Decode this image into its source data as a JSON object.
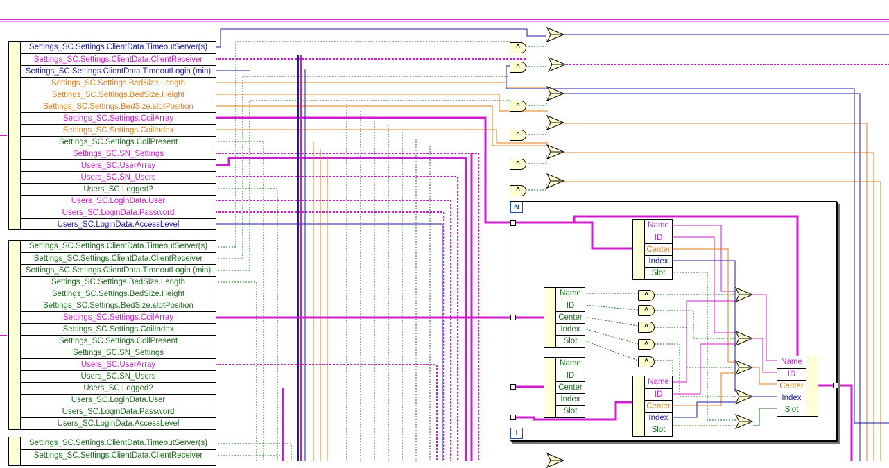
{
  "clusters": [
    {
      "rows": [
        {
          "label": "Settings_SC.Settings.ClientData.TimeoutServer(s)",
          "color": "#1a1aa6"
        },
        {
          "label": "Settings_SC.Settings.ClientData.ClientReceiver",
          "color": "#d01ccf"
        },
        {
          "label": "Settings_SC.Settings.ClientData.TimeoutLogin (min)",
          "color": "#1a1aa6"
        },
        {
          "label": "Settings_SC.Settings.BedSize.Length",
          "color": "#e07e1a"
        },
        {
          "label": "Settings_SC.Settings.BedSize.Height",
          "color": "#e07e1a"
        },
        {
          "label": "Settings_SC.Settings.BedSize.slotPosition",
          "color": "#e07e1a"
        },
        {
          "label": "Settings_SC.Settings.CoilArray",
          "color": "#d01ccf"
        },
        {
          "label": "Settings_SC.Settings.CoilIndex",
          "color": "#e07e1a"
        },
        {
          "label": "Settings_SC.Settings.CoilPresent",
          "color": "#1c6e1c"
        },
        {
          "label": "Settings_SC.SN_Settings",
          "color": "#d01ccf"
        },
        {
          "label": "Users_SC.UserArray",
          "color": "#d01ccf"
        },
        {
          "label": "Users_SC.SN_Users",
          "color": "#d01ccf"
        },
        {
          "label": "Users_SC.Logged?",
          "color": "#1c6e1c"
        },
        {
          "label": "Users_SC.LoginData.User",
          "color": "#d01ccf"
        },
        {
          "label": "Users_SC.LoginData.Password",
          "color": "#d01ccf"
        },
        {
          "label": "Users_SC.LoginData.AccessLevel",
          "color": "#1a1aa6"
        }
      ]
    },
    {
      "rows": [
        {
          "label": "Settings_SC.Settings.ClientData.TimeoutServer(s)",
          "color": "#1c6e1c"
        },
        {
          "label": "Settings_SC.Settings.ClientData.ClientReceiver",
          "color": "#1c6e1c"
        },
        {
          "label": "Settings_SC.Settings.ClientData.TimeoutLogin (min)",
          "color": "#1c6e1c"
        },
        {
          "label": "Settings_SC.Settings.BedSize.Length",
          "color": "#1c6e1c"
        },
        {
          "label": "Settings_SC.Settings.BedSize.Height",
          "color": "#1c6e1c"
        },
        {
          "label": "Settings_SC.Settings.BedSize.slotPosition",
          "color": "#1c6e1c"
        },
        {
          "label": "Settings_SC.Settings.CoilArray",
          "color": "#d01ccf"
        },
        {
          "label": "Settings_SC.Settings.CoilIndex",
          "color": "#1c6e1c"
        },
        {
          "label": "Settings_SC.Settings.CoilPresent",
          "color": "#1c6e1c"
        },
        {
          "label": "Settings_SC.SN_Settings",
          "color": "#1c6e1c"
        },
        {
          "label": "Users_SC.UserArray",
          "color": "#d01ccf"
        },
        {
          "label": "Users_SC.SN_Users",
          "color": "#1c6e1c"
        },
        {
          "label": "Users_SC.Logged?",
          "color": "#1c6e1c"
        },
        {
          "label": "Users_SC.LoginData.User",
          "color": "#1c6e1c"
        },
        {
          "label": "Users_SC.LoginData.Password",
          "color": "#1c6e1c"
        },
        {
          "label": "Users_SC.LoginData.AccessLevel",
          "color": "#1c6e1c"
        }
      ]
    },
    {
      "rows": [
        {
          "label": "Settings_SC.Settings.ClientData.TimeoutServer(s)",
          "color": "#1c6e1c"
        },
        {
          "label": "Settings_SC.Settings.ClientData.ClientReceiver",
          "color": "#1c6e1c"
        }
      ]
    }
  ],
  "coil_clusters": {
    "top": [
      {
        "label": "Name",
        "color": "#d01ccf"
      },
      {
        "label": "ID",
        "color": "#d01ccf"
      },
      {
        "label": "Center",
        "color": "#e07e1a"
      },
      {
        "label": "Index",
        "color": "#1a1aa6"
      },
      {
        "label": "Slot",
        "color": "#1c6e1c"
      }
    ],
    "left_a": [
      {
        "label": "Name",
        "color": "#1c6e1c"
      },
      {
        "label": "ID",
        "color": "#1c6e1c"
      },
      {
        "label": "Center",
        "color": "#1c6e1c"
      },
      {
        "label": "Index",
        "color": "#1c6e1c"
      },
      {
        "label": "Slot",
        "color": "#1c6e1c"
      }
    ],
    "left_b": [
      {
        "label": "Name",
        "color": "#1c6e1c"
      },
      {
        "label": "ID",
        "color": "#1c6e1c"
      },
      {
        "label": "Center",
        "color": "#1c6e1c"
      },
      {
        "label": "Index",
        "color": "#1c6e1c"
      },
      {
        "label": "Slot",
        "color": "#1c6e1c"
      }
    ],
    "bottom": [
      {
        "label": "Name",
        "color": "#d01ccf"
      },
      {
        "label": "ID",
        "color": "#d01ccf"
      },
      {
        "label": "Center",
        "color": "#e07e1a"
      },
      {
        "label": "Index",
        "color": "#1a1aa6"
      },
      {
        "label": "Slot",
        "color": "#1c6e1c"
      }
    ],
    "bundle": [
      {
        "label": "Name",
        "color": "#d01ccf"
      },
      {
        "label": "ID",
        "color": "#d01ccf"
      },
      {
        "label": "Center",
        "color": "#e07e1a"
      },
      {
        "label": "Index",
        "color": "#1a1aa6"
      },
      {
        "label": "Slot",
        "color": "#1c6e1c"
      }
    ]
  },
  "loop": {
    "count_terminal": "N",
    "iteration_terminal": "i"
  },
  "gate_symbol": "^",
  "colors": {
    "navy": "#1a1aa6",
    "pink": "#d01ccf",
    "orange": "#e07e1a",
    "green": "#1c6e1c"
  }
}
